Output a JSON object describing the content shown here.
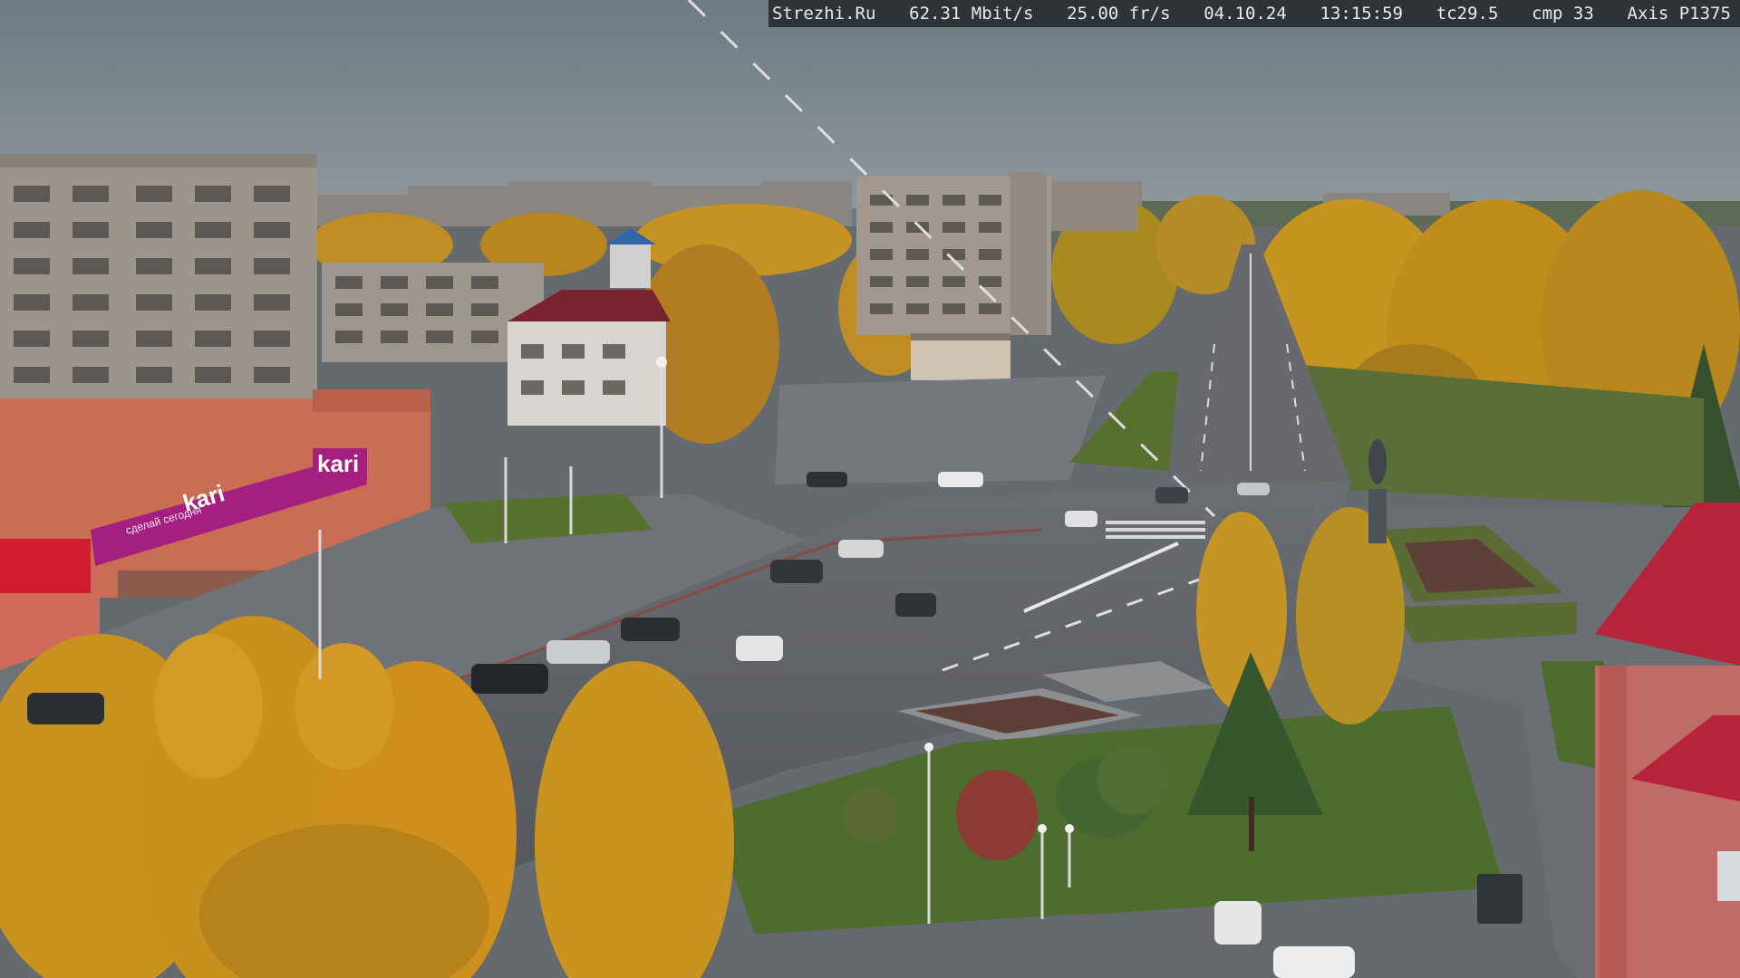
{
  "overlay": {
    "site": "Strezhi.Ru",
    "bitrate": "62.31 Mbit/s",
    "framerate": "25.00 fr/s",
    "date": "04.10.24",
    "time": "13:15:59",
    "tc": "tc29.5",
    "cmp": "cmp 33",
    "camera": "Axis P1375"
  },
  "signs": {
    "store_logo": "kari",
    "store_banner": "kari",
    "store_banner_small": "сделай сегодня"
  },
  "colors": {
    "sky": "#6f7d86",
    "road": "#5e6166",
    "foliage": "#c9921c",
    "grass": "#4f6d32",
    "kari_brand": "#b02a86"
  }
}
